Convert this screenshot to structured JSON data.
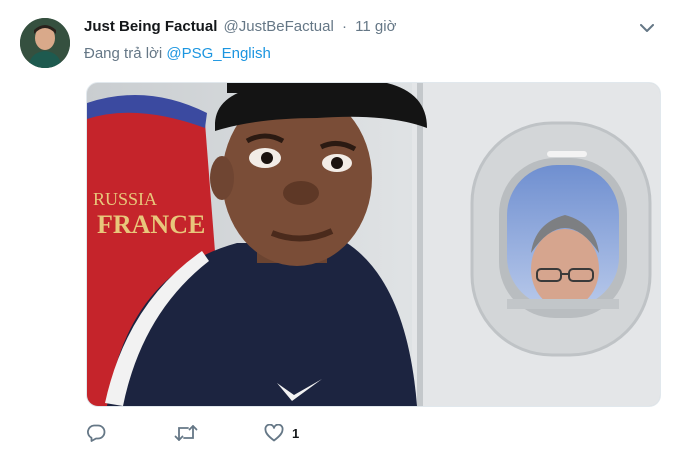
{
  "tweet": {
    "display_name": "Just Being Factual",
    "handle": "@JustBeFactual",
    "separator": "·",
    "time": "11 giờ",
    "reply_prefix": "Đang trả lời",
    "reply_handle": "@PSG_English",
    "like_count": "1"
  },
  "media": {
    "seat_text_line1": "RUSSIA",
    "seat_text_line2": "FRANCE"
  },
  "colors": {
    "link": "#1b95e0",
    "secondary_text": "#657786",
    "icon": "#657786"
  },
  "icons": {
    "menu": "chevron-down-icon",
    "reply": "reply-icon",
    "retweet": "retweet-icon",
    "like": "heart-icon"
  }
}
